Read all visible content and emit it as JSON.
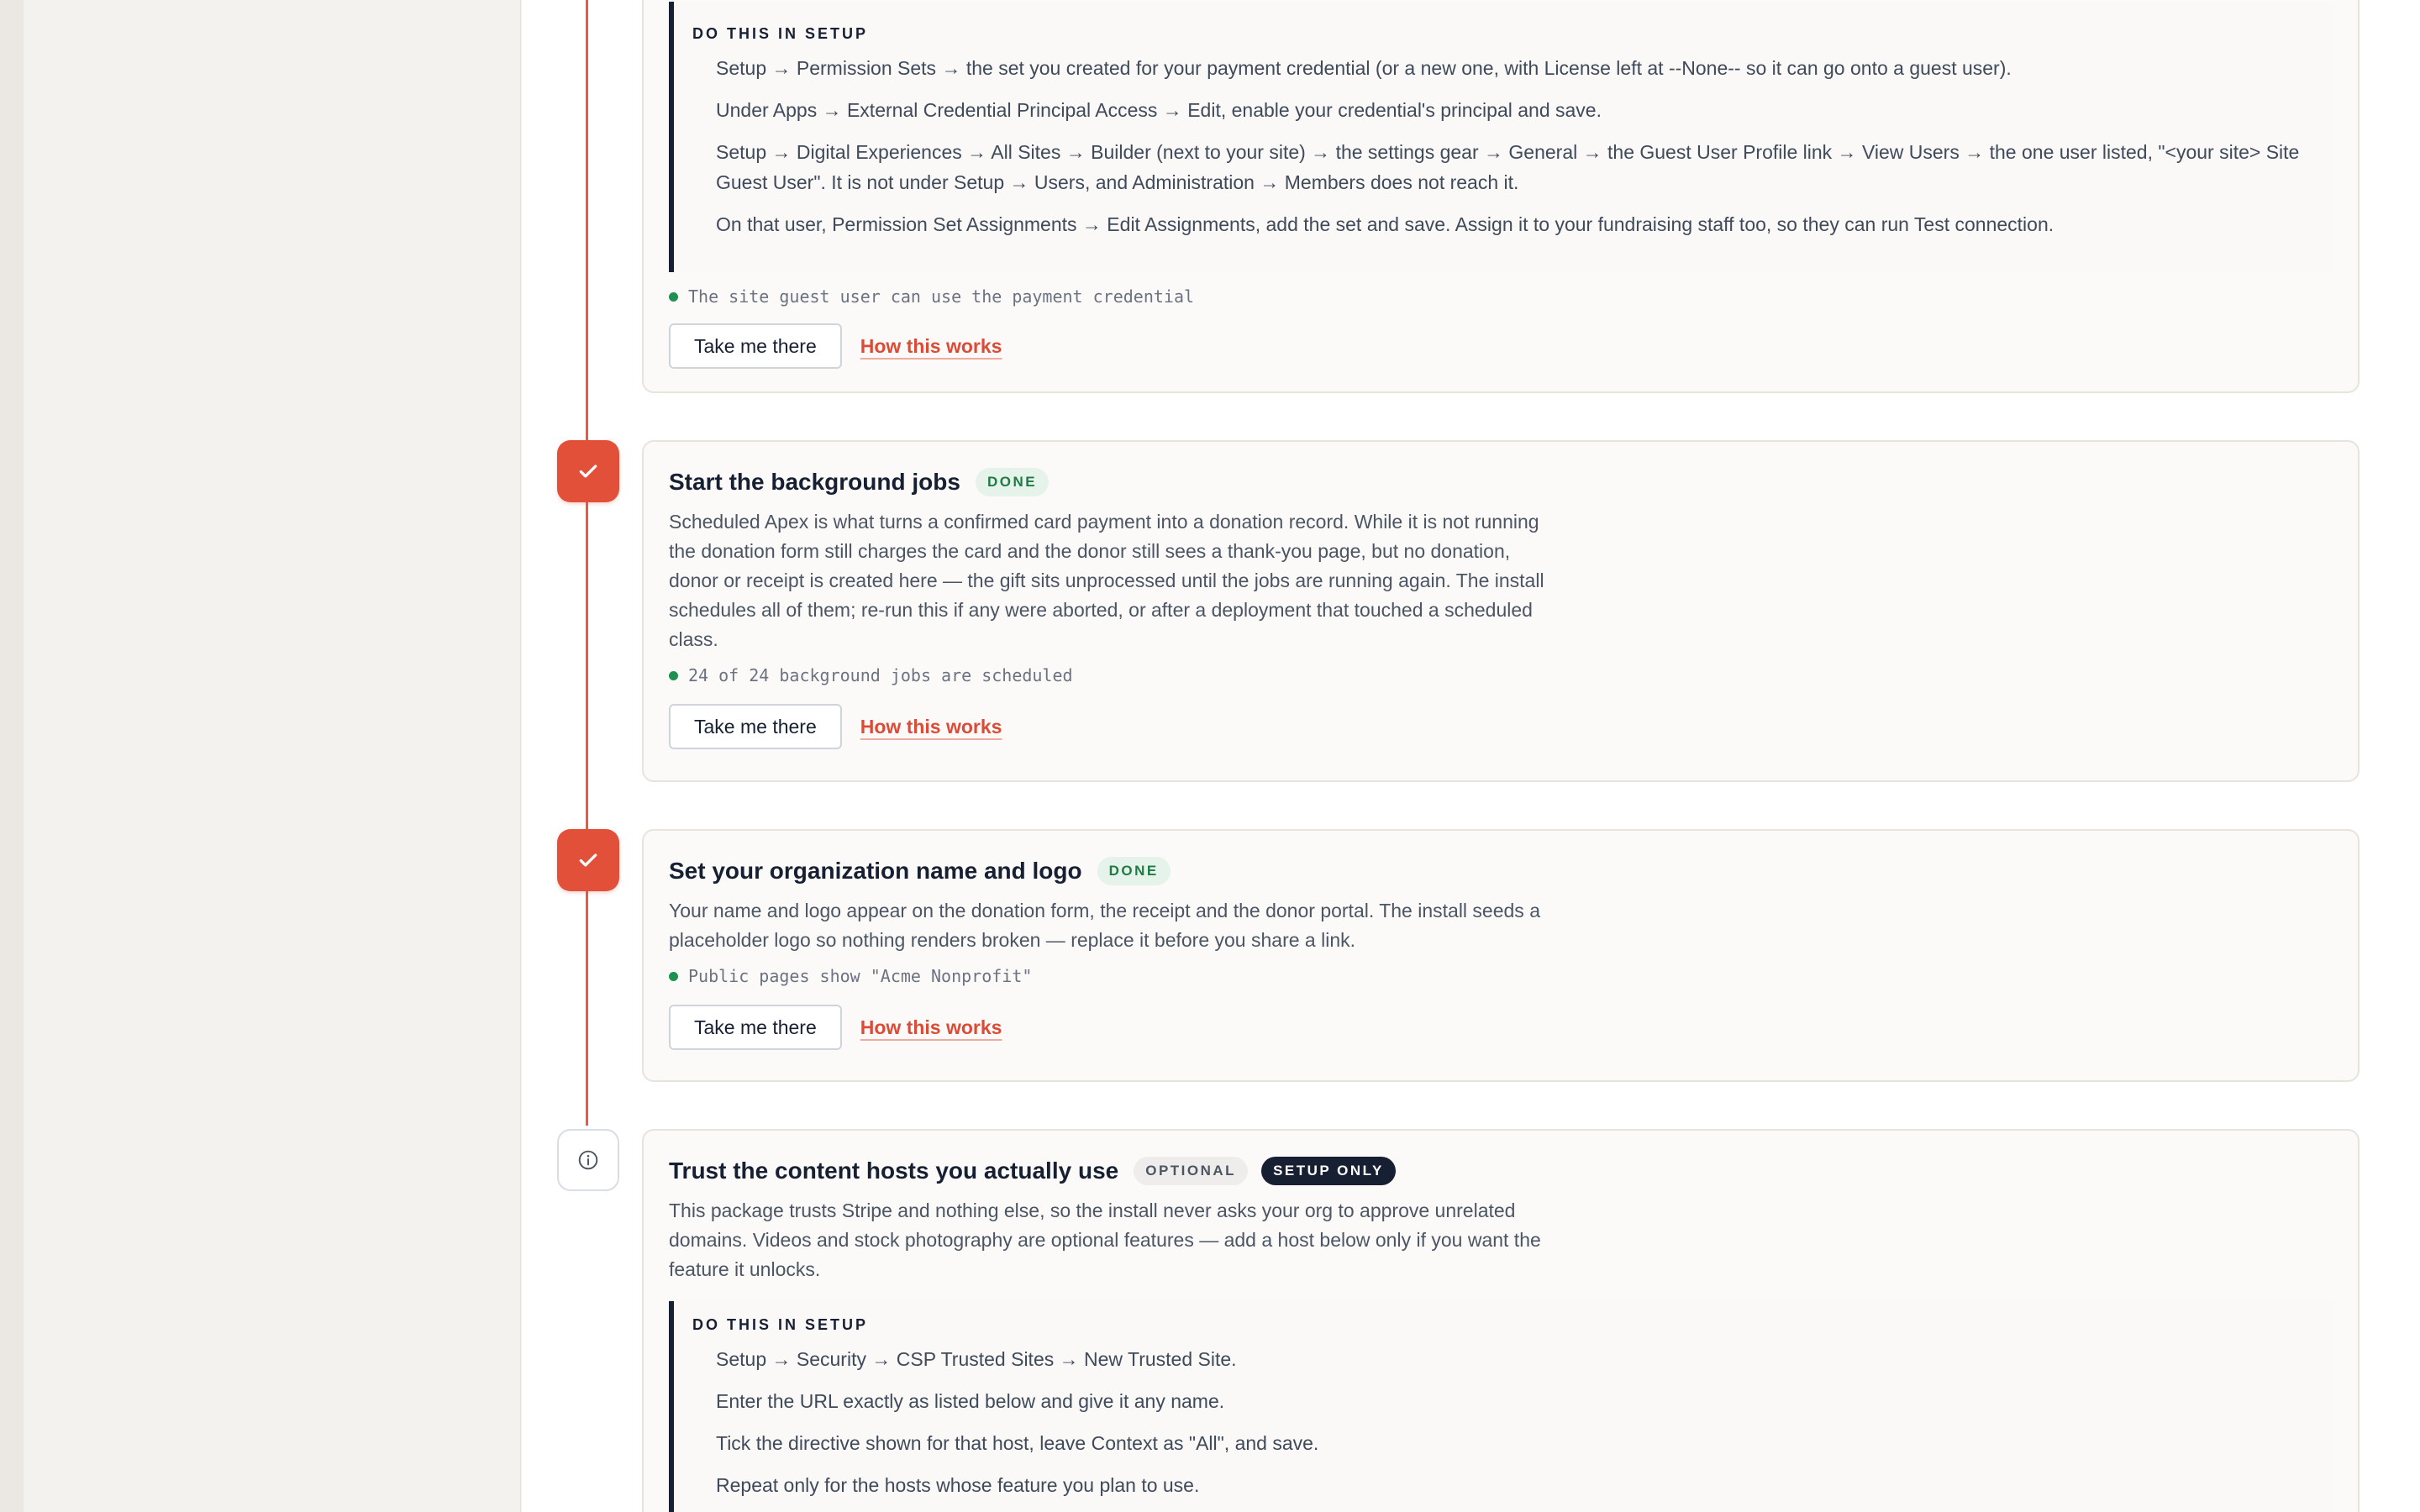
{
  "steps": [
    {
      "state": "partial",
      "setup_block": {
        "heading": "DO THIS IN SETUP",
        "items": [
          "Setup → Permission Sets → the set you created for your payment credential (or a new one, with License left at --None-- so it can go onto a guest user).",
          "Under Apps → External Credential Principal Access → Edit, enable your credential's principal and save.",
          "Setup → Digital Experiences → All Sites → Builder (next to your site) → the settings gear → General → the Guest User Profile link → View Users → the one user listed, \"<your site> Site Guest User\". It is not under Setup → Users, and Administration → Members does not reach it.",
          "On that user, Permission Set Assignments → Edit Assignments, add the set and save. Assign it to your fundraising staff too, so they can run Test connection."
        ]
      },
      "status": "The site guest user can use the payment credential",
      "primary_action": "Take me there",
      "secondary_action": "How this works"
    },
    {
      "state": "done",
      "icon": "check-icon",
      "title": "Start the background jobs",
      "badge": "DONE",
      "description": "Scheduled Apex is what turns a confirmed card payment into a donation record. While it is not running the donation form still charges the card and the donor still sees a thank-you page, but no donation, donor or receipt is created here — the gift sits unprocessed until the jobs are running again. The install schedules all of them; re-run this if any were aborted, or after a deployment that touched a scheduled class.",
      "status": "24 of 24 background jobs are scheduled",
      "primary_action": "Take me there",
      "secondary_action": "How this works"
    },
    {
      "state": "done",
      "icon": "check-icon",
      "title": "Set your organization name and logo",
      "badge": "DONE",
      "description": "Your name and logo appear on the donation form, the receipt and the donor portal. The install seeds a placeholder logo so nothing renders broken — replace it before you share a link.",
      "status": "Public pages show \"Acme Nonprofit\"",
      "primary_action": "Take me there",
      "secondary_action": "How this works"
    },
    {
      "state": "optional",
      "icon": "info-icon",
      "title": "Trust the content hosts you actually use",
      "badge": "OPTIONAL",
      "badge2": "SETUP ONLY",
      "description": "This package trusts Stripe and nothing else, so the install never asks your org to approve unrelated domains. Videos and stock photography are optional features — add a host below only if you want the feature it unlocks.",
      "setup_block": {
        "heading": "DO THIS IN SETUP",
        "items": [
          "Setup → Security → CSP Trusted Sites → New Trusted Site.",
          "Enter the URL exactly as listed below and give it any name.",
          "Tick the directive shown for that host, leave Context as \"All\", and save.",
          "Repeat only for the hosts whose feature you plan to use."
        ]
      }
    }
  ],
  "colors": {
    "accent": "#e2503a",
    "link": "#dc4b35",
    "done_badge_bg": "#e5f3ea",
    "done_badge_text": "#1f7a44",
    "navy": "#172033",
    "status_dot": "#1f8f52"
  }
}
